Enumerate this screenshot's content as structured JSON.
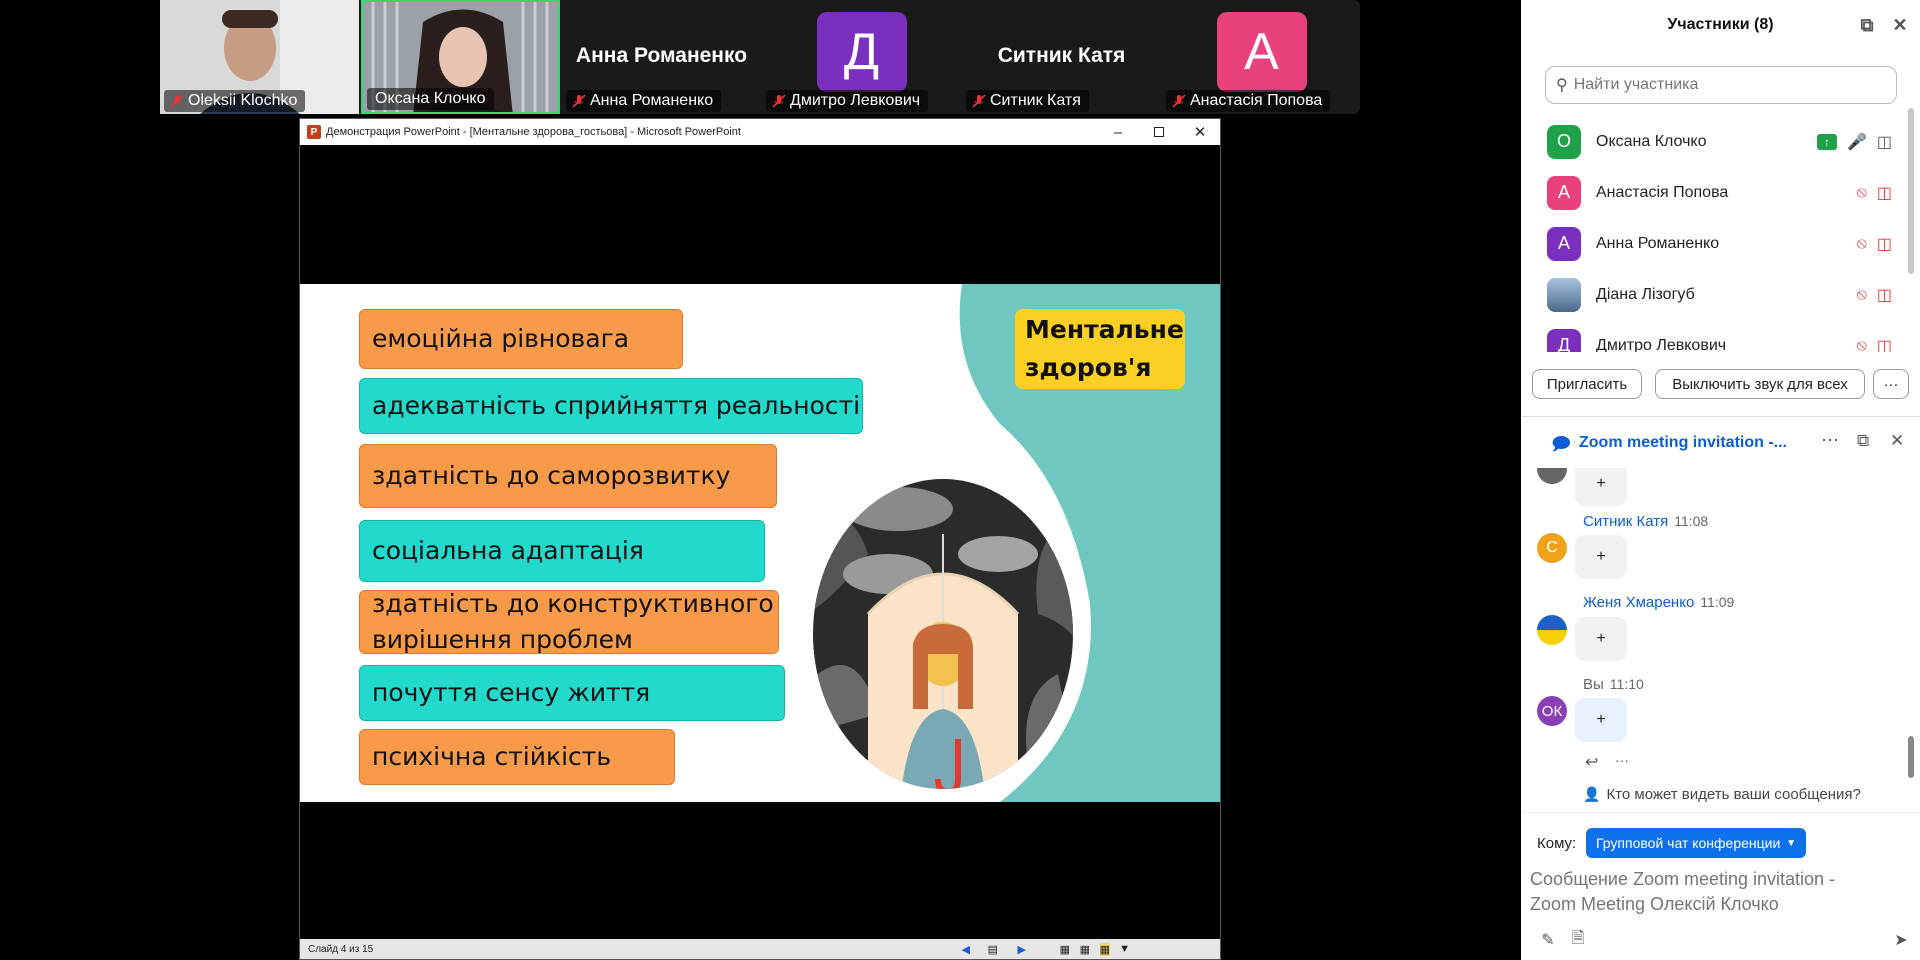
{
  "video_tiles": [
    {
      "name": "Oleksii Klochko",
      "type": "video"
    },
    {
      "name": "Оксана Клочко",
      "type": "video",
      "active_speaker": true
    },
    {
      "name": "Анна Романенко",
      "big_name": "Анна Романенко",
      "type": "name"
    },
    {
      "name": "Дмитро Левкович",
      "initial": "Д",
      "color": "#7b2fbe",
      "type": "avatar"
    },
    {
      "name": "Ситник Катя",
      "big_name": "Ситник Катя",
      "type": "name"
    },
    {
      "name": "Анастасія Попова",
      "initial": "А",
      "color": "#e8417e",
      "type": "avatar"
    }
  ],
  "ppt": {
    "title": "Демонстрация PowerPoint - [Ментальне здорова_гостьова] - Microsoft PowerPoint",
    "status": "Слайд 4 из 15",
    "slide": {
      "title_line1": "Ментальне",
      "title_line2": "здоров'я",
      "items": [
        {
          "text": "емоційна рівновага",
          "color": "orange"
        },
        {
          "text": "адекватність сприйняття реальності",
          "color": "teal"
        },
        {
          "text": "здатність до саморозвитку",
          "color": "orange"
        },
        {
          "text": "соціальна адаптація",
          "color": "teal"
        },
        {
          "line1": "здатність до конструктивного",
          "line2": "вирішення проблем",
          "color": "orange"
        },
        {
          "text": "почуття сенсу життя",
          "color": "teal"
        },
        {
          "text": "психічна стійкість",
          "color": "orange"
        }
      ]
    }
  },
  "participants": {
    "title": "Участники (8)",
    "search_placeholder": "Найти участника",
    "list": [
      {
        "name": "Оксана Клочко",
        "initial": "О",
        "color": "#1fa14a",
        "muted": false
      },
      {
        "name": "Анастасія Попова",
        "initial": "А",
        "color": "#e8417e",
        "muted": true
      },
      {
        "name": "Анна Романенко",
        "initial": "А",
        "color": "#7b2fbe",
        "muted": true
      },
      {
        "name": "Діана Лізогуб",
        "initial": "",
        "color": "#6f8fb8",
        "muted": true
      },
      {
        "name": "Дмитро Левкович",
        "initial": "Д",
        "color": "#7b2fbe",
        "muted": true
      }
    ],
    "invite_label": "Пригласить",
    "mute_all_label": "Выключить звук для всех",
    "more_label": "···"
  },
  "chat": {
    "title": "Zoom meeting invitation -...",
    "messages": [
      {
        "sender": "",
        "time": "",
        "text": "+",
        "initial": "",
        "color": "#666"
      },
      {
        "sender": "Ситник Катя",
        "time": "11:08",
        "text": "+",
        "initial": "С",
        "color": "#f0a21b"
      },
      {
        "sender": "Женя Хмаренко",
        "time": "11:09",
        "text": "+",
        "initial": "",
        "color": "#1f5fc8"
      },
      {
        "sender": "Вы",
        "time": "11:10",
        "text": "+",
        "initial": "ОК",
        "color": "#8a3fb5"
      }
    ],
    "who_can_see": "Кто может видеть ваши сообщения?",
    "to_label": "Кому:",
    "to_value": "Групповой чат конференции",
    "message_placeholder": "Сообщение Zoom meeting invitation - Zoom Meeting Олексій Клочко",
    "reaction_more": "···"
  }
}
